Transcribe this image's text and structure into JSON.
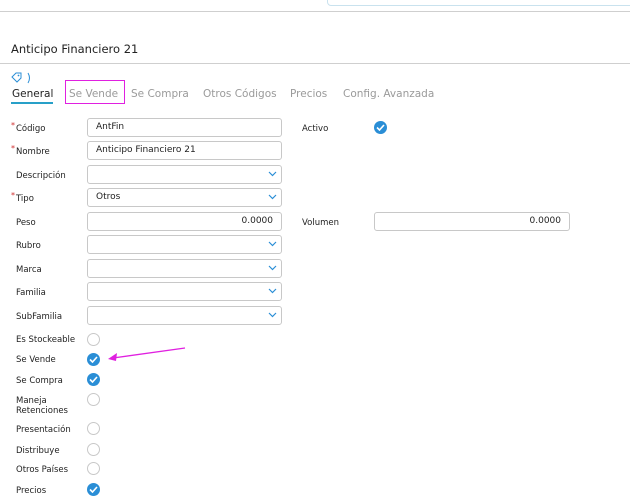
{
  "page": {
    "title": "Anticipo Financiero 21"
  },
  "tabs": [
    {
      "label": "General",
      "active": true
    },
    {
      "label": "Se Vende",
      "active": false
    },
    {
      "label": "Se Compra",
      "active": false
    },
    {
      "label": "Otros Códigos",
      "active": false
    },
    {
      "label": "Precios",
      "active": false
    },
    {
      "label": "Config. Avanzada",
      "active": false
    }
  ],
  "form": {
    "codigo": {
      "label": "Código",
      "value": "AntFin",
      "required": true
    },
    "nombre": {
      "label": "Nombre",
      "value": "Anticipo Financiero 21",
      "required": true
    },
    "descripcion": {
      "label": "Descripción",
      "value": ""
    },
    "tipo": {
      "label": "Tipo",
      "value": "Otros",
      "required": true
    },
    "peso": {
      "label": "Peso",
      "value": "0.0000"
    },
    "volumen": {
      "label": "Volumen",
      "value": "0.0000"
    },
    "rubro": {
      "label": "Rubro",
      "value": ""
    },
    "marca": {
      "label": "Marca",
      "value": ""
    },
    "familia": {
      "label": "Familia",
      "value": ""
    },
    "subfamilia": {
      "label": "SubFamilia",
      "value": ""
    },
    "activo": {
      "label": "Activo",
      "checked": true
    }
  },
  "flags": [
    {
      "label": "Es Stockeable",
      "checked": false
    },
    {
      "label": "Se Vende",
      "checked": true
    },
    {
      "label": "Se Compra",
      "checked": true
    },
    {
      "label": "Maneja Retenciones",
      "checked": false
    },
    {
      "label": "Presentación",
      "checked": false
    },
    {
      "label": "Distribuye",
      "checked": false
    },
    {
      "label": "Otros Países",
      "checked": false
    },
    {
      "label": "Precios",
      "checked": true
    }
  ],
  "colors": {
    "accent": "#2a8ed6",
    "tab_underline": "#28a0c8",
    "annotation": "#e020e0",
    "required": "#d03030"
  },
  "icons": {
    "tag": "tag-icon",
    "chevron": "chevron-down-icon",
    "check": "checkmark-icon",
    "annotation_arrow": "arrow-icon"
  }
}
